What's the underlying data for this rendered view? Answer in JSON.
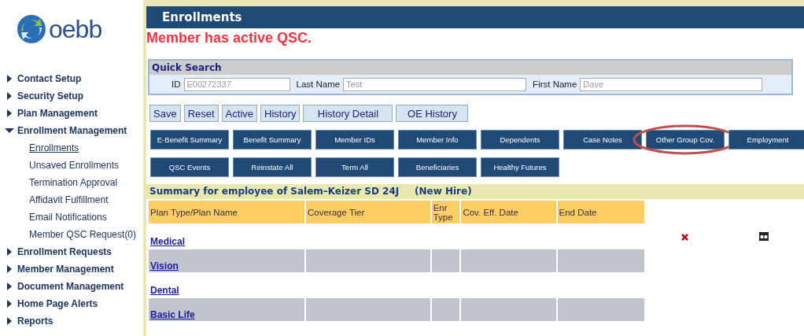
{
  "logo": {
    "text": "oebb"
  },
  "sidebar": {
    "items": [
      {
        "label": "Contact Setup",
        "expanded": false
      },
      {
        "label": "Security Setup",
        "expanded": false
      },
      {
        "label": "Plan Management",
        "expanded": false
      },
      {
        "label": "Enrollment Management",
        "expanded": true,
        "children": [
          {
            "label": "Enrollments",
            "selected": true
          },
          {
            "label": "Unsaved Enrollments",
            "selected": false
          },
          {
            "label": "Termination Approval",
            "selected": false
          },
          {
            "label": "Affidavit Fulfillment",
            "selected": false
          },
          {
            "label": "Email Notifications",
            "selected": false
          },
          {
            "label": "Member QSC Request(0)",
            "selected": false
          }
        ]
      },
      {
        "label": "Enrollment Requests",
        "expanded": false
      },
      {
        "label": "Member Management",
        "expanded": false
      },
      {
        "label": "Document Management",
        "expanded": false
      },
      {
        "label": "Home Page Alerts",
        "expanded": false
      },
      {
        "label": "Reports",
        "expanded": false
      }
    ]
  },
  "page_title": "Enrollments",
  "alert": "Member has active QSC.",
  "quick_search": {
    "title": "Quick Search",
    "fields": [
      {
        "label": "ID",
        "placeholder": "E00272337"
      },
      {
        "label": "Last Name",
        "placeholder": "Test"
      },
      {
        "label": "First Name",
        "placeholder": "Dave"
      }
    ]
  },
  "action_buttons": [
    "Save",
    "Reset",
    "Active",
    "History",
    "History Detail",
    "OE History"
  ],
  "nav_buttons": [
    [
      {
        "label": "E-Benefit Summary",
        "highlighted": false
      },
      {
        "label": "Benefit Summary",
        "highlighted": false
      },
      {
        "label": "Member IDs",
        "highlighted": false
      },
      {
        "label": "Member Info",
        "highlighted": false
      },
      {
        "label": "Dependents",
        "highlighted": false
      },
      {
        "label": "Case Notes",
        "highlighted": false
      },
      {
        "label": "Other Group Cov.",
        "highlighted": true
      },
      {
        "label": "Employment",
        "highlighted": false
      }
    ],
    [
      {
        "label": "QSC Events",
        "highlighted": false
      },
      {
        "label": "Reinstate All",
        "highlighted": false
      },
      {
        "label": "Term All",
        "highlighted": false
      },
      {
        "label": "Beneficiaries",
        "highlighted": false
      },
      {
        "label": "Healthy Futures",
        "highlighted": false
      }
    ]
  ],
  "summary": {
    "title": "Summary for employee of Salem–Keizer SD 24J",
    "status": "(New Hire)"
  },
  "table": {
    "columns": [
      "Plan Type/Plan Name",
      "Coverage Tier",
      "Enr Type",
      "Cov. Eff. Date",
      "End Date"
    ],
    "rows": [
      {
        "plan": "Medical",
        "shaded": false,
        "actions": true
      },
      {
        "plan": "Vision",
        "shaded": true,
        "actions": false
      },
      {
        "plan": "Dental",
        "shaded": false,
        "actions": false
      },
      {
        "plan": "Basic Life",
        "shaded": true,
        "actions": false
      }
    ]
  }
}
